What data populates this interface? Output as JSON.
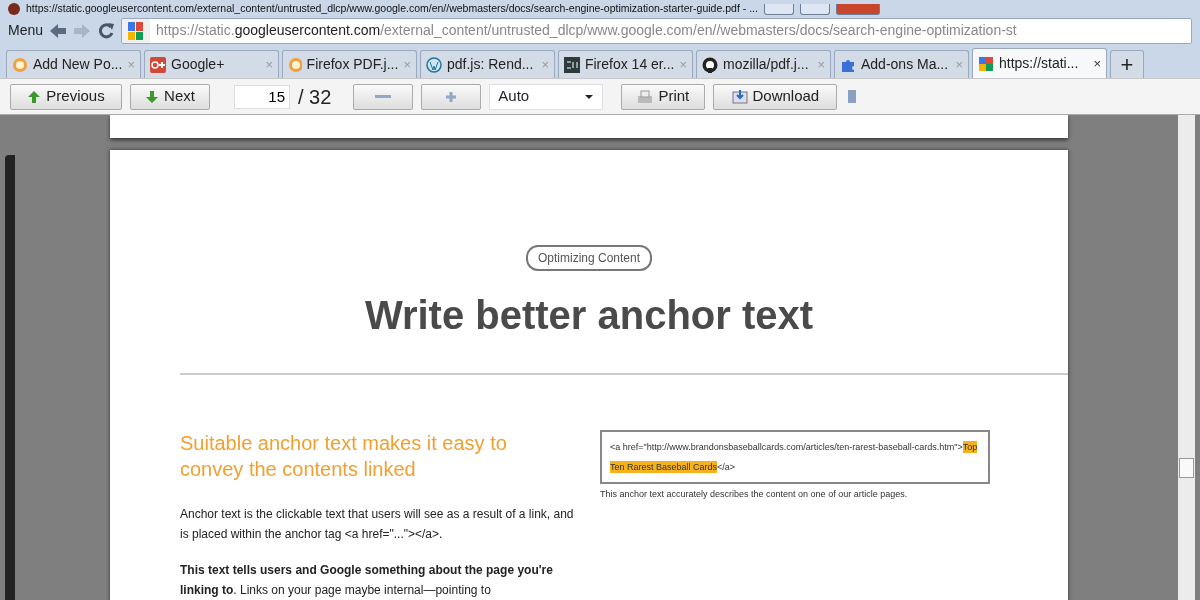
{
  "window": {
    "title": "https://static.googleusercontent.com/external_content/untrusted_dlcp/www.google.com/en//webmasters/docs/search-engine-optimization-starter-guide.pdf - ..."
  },
  "toolbar": {
    "menu": "Menu",
    "address": {
      "scheme": "https://static.",
      "domain": "googleusercontent.com",
      "path": "/external_content/untrusted_dlcp/www.google.com/en//webmasters/docs/search-engine-optimization-st"
    }
  },
  "tabs": [
    {
      "label": "Add New Po...",
      "close": "×",
      "selected": false
    },
    {
      "label": "Google+",
      "close": "×",
      "selected": false
    },
    {
      "label": "Firefox PDF.j...",
      "close": "×",
      "selected": false
    },
    {
      "label": "pdf.js: Rend...",
      "close": "×",
      "selected": false
    },
    {
      "label": "Firefox 14 er...",
      "close": "×",
      "selected": false
    },
    {
      "label": "mozilla/pdf.j...",
      "close": "×",
      "selected": false
    },
    {
      "label": "Add-ons Ma...",
      "close": "×",
      "selected": false
    },
    {
      "label": "https://stati...",
      "close": "×",
      "selected": true
    }
  ],
  "new_tab": "+",
  "pdf_toolbar": {
    "previous": "Previous",
    "next": "Next",
    "page": "15",
    "page_count": "/ 32",
    "zoom": "Auto",
    "print": "Print",
    "download": "Download"
  },
  "document": {
    "section_badge": "Optimizing Content",
    "title": "Write better anchor text",
    "subheading": "Suitable anchor text makes it easy to convey the contents linked",
    "paragraphs": [
      "Anchor text is the clickable text that users will see as a result of a link, and is placed within the anchor tag <a href=\"...\"></a>.",
      "**This text tells users and Google something about the page you're linking to**. Links on your page maybe internal—pointing to"
    ],
    "code": {
      "before": "<a href=\"http://www.brandonsbaseballcards.com/articles/ten-rarest-baseball-cards.htm\">",
      "highlight": "Top Ten Rarest Baseball Cards",
      "after": "</a>"
    },
    "caption": "This anchor text accurately describes the content on one of our article pages."
  }
}
